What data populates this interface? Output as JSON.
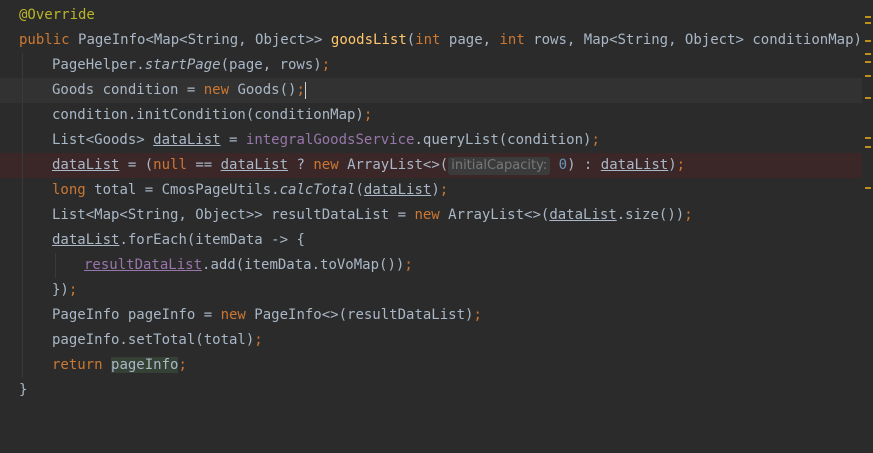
{
  "code": {
    "l1_annotation": "@Override",
    "l2_public": "public ",
    "l2_ret": "PageInfo<Map<String, Object>> ",
    "l2_method": "goodsList",
    "l2_paren": "(",
    "l2_int1": "int ",
    "l2_page": "page, ",
    "l2_int2": "int ",
    "l2_rows": "rows, ",
    "l2_map": "Map<String, Object> conditionMap) {",
    "l3_cls": "PageHelper.",
    "l3_method": "startPage",
    "l3_args": "(page, rows)",
    "l3_semi": ";",
    "l4_a": "Goods condition = ",
    "l4_new": "new ",
    "l4_b": "Goods()",
    "l4_semi": ";",
    "l5_a": "condition.initCondition(conditionMap)",
    "l5_semi": ";",
    "l6_a": "List<Goods> ",
    "l6_var": "dataList",
    "l6_b": " = ",
    "l6_field": "integralGoodsService",
    "l6_c": ".queryList(condition)",
    "l6_semi": ";",
    "l7_var": "dataList",
    "l7_a": " = (",
    "l7_null": "null ",
    "l7_b": "== ",
    "l7_var2": "dataList",
    "l7_c": " ? ",
    "l7_new": "new ",
    "l7_d": "ArrayList<>(",
    "l7_hint": "initialCapacity:",
    "l7_num": " 0",
    "l7_e": ") : ",
    "l7_var3": "dataList",
    "l7_f": ")",
    "l7_semi": ";",
    "l8_long": "long ",
    "l8_a": "total = CmosPageUtils.",
    "l8_method": "calcTotal",
    "l8_b": "(",
    "l8_var": "dataList",
    "l8_c": ")",
    "l8_semi": ";",
    "l9_a": "List<Map<String, Object>> resultDataList = ",
    "l9_new": "new ",
    "l9_b": "ArrayList<>(",
    "l9_var": "dataList",
    "l9_c": ".size())",
    "l9_semi": ";",
    "l10_var": "dataList",
    "l10_a": ".forEach(itemData -> {",
    "l11_var": "resultDataList",
    "l11_a": ".add(itemData.toVoMap())",
    "l11_semi": ";",
    "l12_a": "})",
    "l12_semi": ";",
    "l13_a": "PageInfo pageInfo = ",
    "l13_new": "new ",
    "l13_b": "PageInfo<>(resultDataList)",
    "l13_semi": ";",
    "l14_a": "pageInfo.setTotal(total)",
    "l14_semi": ";",
    "l15_return": "return ",
    "l15_var": "pageInfo",
    "l15_semi": ";",
    "l16_a": "}"
  },
  "colors": {
    "background": "#2b2b2b",
    "keyword": "#cc7832",
    "annotation": "#bbb529",
    "method": "#ffc66d",
    "field": "#9876aa",
    "number": "#6897bb",
    "text": "#a9b7c6",
    "error_line": "#3b2728",
    "marker": "#be9117"
  }
}
